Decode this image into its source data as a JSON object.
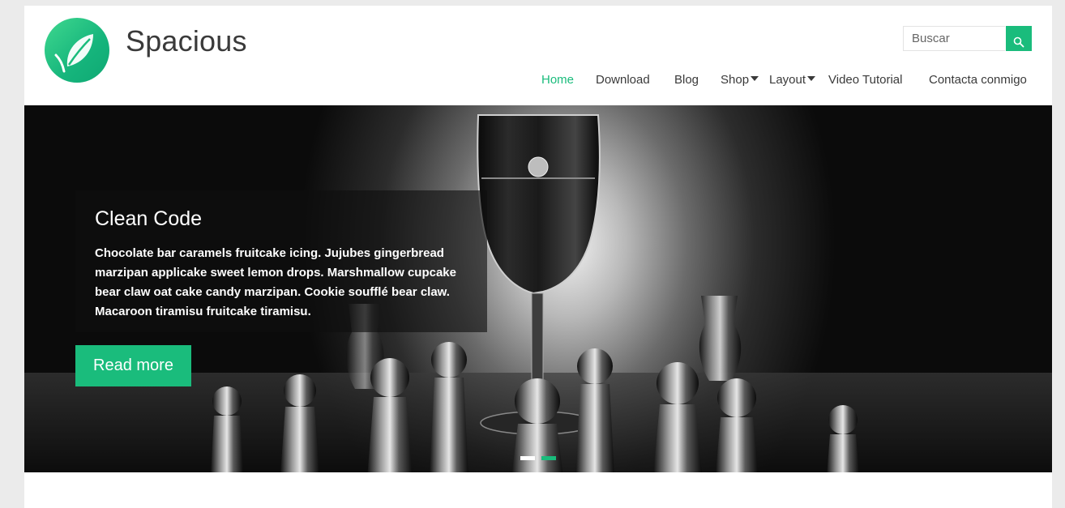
{
  "site": {
    "title": "Spacious",
    "logo_icon": "leaf-icon"
  },
  "search": {
    "placeholder": "Buscar",
    "button_icon": "search-icon"
  },
  "nav": {
    "items": [
      {
        "label": "Home",
        "active": true
      },
      {
        "label": "Download"
      },
      {
        "label": "Blog"
      },
      {
        "label": "Shop",
        "has_dropdown": true
      },
      {
        "label": "Layout",
        "has_dropdown": true
      },
      {
        "label": "Video Tutorial"
      },
      {
        "label": "Contacta conmigo"
      }
    ]
  },
  "slider": {
    "title": "Clean Code",
    "text": "Chocolate bar caramels fruitcake icing. Jujubes gingerbread marzipan applicake sweet lemon drops. Marshmallow cupcake bear claw oat cake candy marzipan. Cookie soufflé bear claw. Macaroon tiramisu fruitcake tiramisu.",
    "button_label": "Read more",
    "pager": {
      "count": 2,
      "current": 2
    }
  },
  "colors": {
    "accent": "#1abc7c",
    "text": "#3a3a3a",
    "pager_inactive": "#ffffff"
  }
}
